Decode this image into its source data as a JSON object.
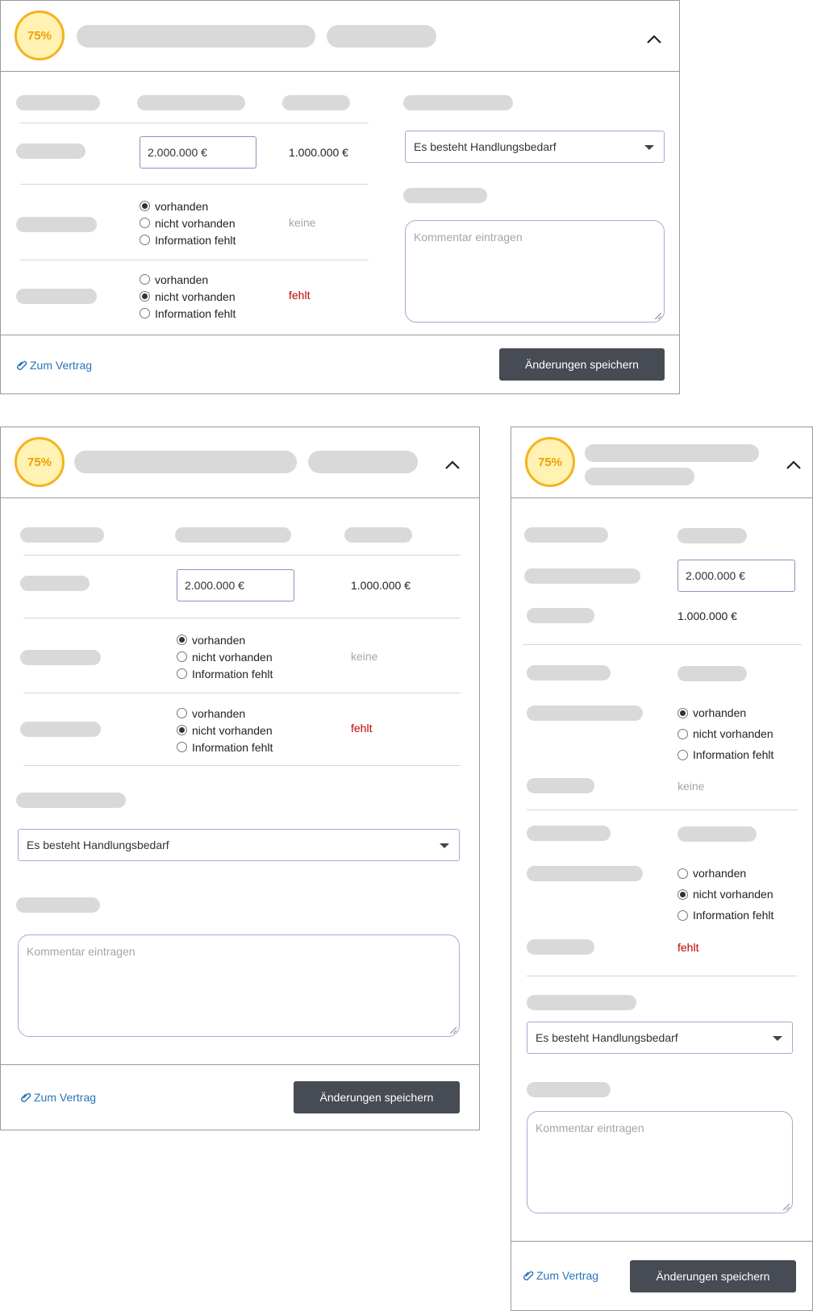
{
  "badge": {
    "percent": "75%"
  },
  "fields": {
    "amount_input": "2.000.000 €",
    "reference_amount": "1.000.000 €"
  },
  "radios": {
    "options": [
      "vorhanden",
      "nicht vorhanden",
      "Information fehlt"
    ],
    "group1_selected": "vorhanden",
    "group1_status": "keine",
    "group2_selected": "nicht vorhanden",
    "group2_status": "fehlt"
  },
  "assessment": {
    "selected": "Es besteht Handlungsbedarf"
  },
  "comment": {
    "placeholder": "Kommentar eintragen"
  },
  "footer": {
    "link_label": "Zum Vertrag",
    "save_label": "Änderungen speichern"
  },
  "colors": {
    "badge_fill": "#fff2b3",
    "badge_border": "#f5b21f",
    "badge_text": "#ef9f00",
    "missing_status": "#c00000",
    "link": "#2a73b8",
    "primary_button": "#464b54"
  },
  "icons": {
    "collapse": "chevron-up-icon",
    "link": "paperclip-icon",
    "dropdown": "caret-down-icon",
    "resize": "resize-grip-icon"
  }
}
